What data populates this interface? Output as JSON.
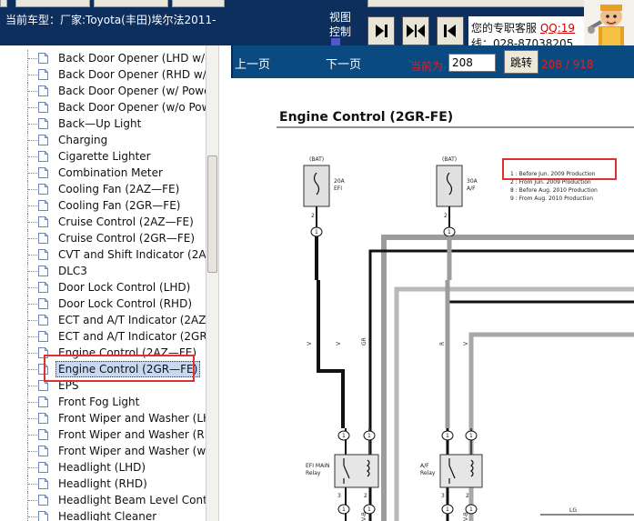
{
  "header": {
    "car_label": "当前车型：厂家:Toyota(丰田)埃尔法2011-",
    "view_control_line1": "视图",
    "view_control_line2": "控制",
    "support_text": "您的专职客服",
    "support_qq": "QQ:19",
    "support_phone": "线：028-87038205",
    "nav_buttons": [
      "prev-page-icon",
      "fit-width-icon",
      "next-page-icon"
    ]
  },
  "sidebar": {
    "items": [
      "Back Door Opener (LHD w/o",
      "Back Door Opener (RHD w/o",
      "Back Door Opener (w/ Power",
      "Back Door Opener (w/o Power",
      "Back—Up Light",
      "Charging",
      "Cigarette Lighter",
      "Combination Meter",
      "Cooling Fan (2AZ—FE)",
      "Cooling Fan (2GR—FE)",
      "Cruise Control (2AZ—FE)",
      "Cruise Control (2GR—FE)",
      "CVT and Shift Indicator (2AZ",
      "DLC3",
      "Door Lock Control (LHD)",
      "Door Lock Control (RHD)",
      "ECT and A/T Indicator (2AZ-",
      "ECT and A/T Indicator (2GR",
      "Engine Control (2AZ—FE)",
      "Engine Control (2GR—FE)",
      "EPS",
      "Front Fog Light",
      "Front Wiper and Washer (LHD",
      "Front Wiper and Washer (RHD",
      "Front Wiper and Washer (w/",
      "Headlight (LHD)",
      "Headlight (RHD)",
      "Headlight Beam Level Contro",
      "Headlight Cleaner"
    ],
    "selected_index": 19
  },
  "toolbar": {
    "prev_label": "上一页",
    "next_label": "下一页",
    "current_label": "当前为",
    "page_value": "208",
    "jump_label": "跳转",
    "page_count": "208 / 918"
  },
  "diagram": {
    "title": "Engine Control (2GR-FE)",
    "fuse1_source": "(BAT)",
    "fuse1_rating": "20A",
    "fuse1_name": "EFI",
    "fuse2_source": "(BAT)",
    "fuse2_rating": "30A",
    "fuse2_name": "A/F",
    "pin_2": "2",
    "connector_1": "1",
    "legend": [
      "1 : Before Jun. 2009 Production",
      "2 : From Jun. 2009 Production",
      "8 : Before Aug. 2010 Production",
      "9 : From Aug. 2010 Production"
    ],
    "wire_v": "V",
    "wire_gr": "GR",
    "wire_r": "R",
    "wire_lg": "LG",
    "wire_vb": "V-B",
    "relay1_name": "EFI MAIN",
    "relay1_sub": "Relay",
    "relay2_name": "A/F",
    "relay2_sub": "Relay",
    "pin_5": "5",
    "pin_3": "3",
    "pin_1": "1",
    "pin_2b": "2",
    "connector_1b": "1"
  },
  "colors": {
    "header_bg": "#0c2f5e",
    "nav_bar_bg": "#0a4a80",
    "accent_red": "#e02020",
    "selection_bg": "#c8d8f0"
  }
}
